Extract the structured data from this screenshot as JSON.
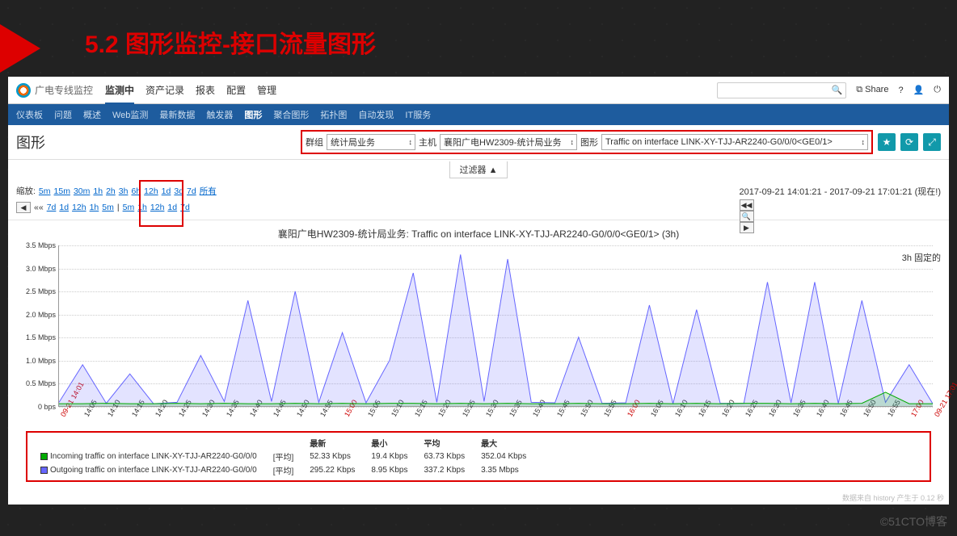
{
  "slide": {
    "title": "5.2  图形监控-接口流量图形"
  },
  "brand": "广电专线监控",
  "topnav": [
    "监测中",
    "资产记录",
    "报表",
    "配置",
    "管理"
  ],
  "topnav_active": 0,
  "toptools": {
    "share": "Share"
  },
  "subnav": [
    "仪表板",
    "问题",
    "概述",
    "Web监测",
    "最新数据",
    "触发器",
    "图形",
    "聚合图形",
    "拓扑图",
    "自动发现",
    "IT服务"
  ],
  "subnav_active": 6,
  "page_title": "图形",
  "filters": {
    "group_lbl": "群组",
    "group_val": "统计局业务",
    "host_lbl": "主机",
    "host_val": "襄阳广电HW2309-统计局业务",
    "graph_lbl": "图形",
    "graph_val": "Traffic on interface LINK-XY-TJJ-AR2240-G0/0/0<GE0/1>"
  },
  "filter_toggle": "过滤器 ▲",
  "zoom": {
    "label": "缩放:",
    "opts": [
      "5m",
      "15m",
      "30m",
      "1h",
      "2h",
      "3h",
      "6h",
      "12h",
      "1d",
      "3d",
      "7d",
      "所有"
    ]
  },
  "navleft": {
    "opts": [
      "7d",
      "1d",
      "12h",
      "1h",
      "5m"
    ]
  },
  "navright": {
    "opts": [
      "5m",
      "1h",
      "12h",
      "1d",
      "7d"
    ]
  },
  "timespan": "2017-09-21 14:01:21 - 2017-09-21 17:01:21 (现在!)",
  "fixmode": "3h  固定的",
  "chart_data": {
    "type": "line",
    "title": "襄阳广电HW2309-统计局业务: Traffic on interface LINK-XY-TJJ-AR2240-G0/0/0<GE0/1> (3h)",
    "ylabel": "",
    "ylim": [
      0,
      3.5
    ],
    "yticks": [
      {
        "v": 0,
        "l": "0 bps"
      },
      {
        "v": 0.5,
        "l": "0.5 Mbps"
      },
      {
        "v": 1.0,
        "l": "1.0 Mbps"
      },
      {
        "v": 1.5,
        "l": "1.5 Mbps"
      },
      {
        "v": 2.0,
        "l": "2.0 Mbps"
      },
      {
        "v": 2.5,
        "l": "2.5 Mbps"
      },
      {
        "v": 3.0,
        "l": "3.0 Mbps"
      },
      {
        "v": 3.5,
        "l": "3.5 Mbps"
      }
    ],
    "x": [
      "09-21 14:01",
      "14:05",
      "14:10",
      "14:15",
      "14:20",
      "14:25",
      "14:30",
      "14:35",
      "14:40",
      "14:45",
      "14:50",
      "14:55",
      "15:00",
      "15:05",
      "15:10",
      "15:15",
      "15:20",
      "15:25",
      "15:30",
      "15:35",
      "15:40",
      "15:45",
      "15:50",
      "15:55",
      "16:00",
      "16:05",
      "16:10",
      "16:15",
      "16:20",
      "16:25",
      "16:30",
      "16:35",
      "16:40",
      "16:45",
      "16:50",
      "16:55",
      "17:00",
      "09-21 17:01"
    ],
    "series": [
      {
        "name": "Incoming traffic on interface LINK-XY-TJJ-AR2240-G0/0/0<GE0/1>",
        "color": "#0a0",
        "agg": "[平均]",
        "latest": "52.33 Kbps",
        "min": "19.4 Kbps",
        "avg": "63.73 Kbps",
        "max": "352.04 Kbps",
        "values": [
          0.05,
          0.05,
          0.06,
          0.05,
          0.05,
          0.06,
          0.05,
          0.06,
          0.05,
          0.05,
          0.06,
          0.05,
          0.06,
          0.05,
          0.06,
          0.06,
          0.05,
          0.06,
          0.05,
          0.06,
          0.05,
          0.05,
          0.06,
          0.05,
          0.05,
          0.06,
          0.05,
          0.06,
          0.05,
          0.06,
          0.06,
          0.05,
          0.06,
          0.05,
          0.06,
          0.3,
          0.05,
          0.05
        ]
      },
      {
        "name": "Outgoing traffic on interface LINK-XY-TJJ-AR2240-G0/0/0<GE0/1>",
        "color": "#66f",
        "agg": "[平均]",
        "latest": "295.22 Kbps",
        "min": "8.95 Kbps",
        "avg": "337.2 Kbps",
        "max": "3.35 Mbps",
        "values": [
          0.08,
          0.9,
          0.06,
          0.7,
          0.05,
          0.08,
          1.1,
          0.1,
          2.3,
          0.1,
          2.5,
          0.08,
          1.6,
          0.07,
          1.0,
          2.9,
          0.08,
          3.3,
          0.1,
          3.2,
          0.08,
          0.07,
          1.5,
          0.06,
          0.07,
          2.2,
          0.05,
          2.1,
          0.06,
          0.06,
          2.7,
          0.07,
          2.7,
          0.06,
          2.3,
          0.08,
          0.9,
          0.05
        ]
      }
    ]
  },
  "legend_headers": [
    "最新",
    "最小",
    "平均",
    "最大"
  ],
  "watermark": "数据来自 history  产生于 0.12 秒",
  "outer_watermark": "©51CTO博客"
}
